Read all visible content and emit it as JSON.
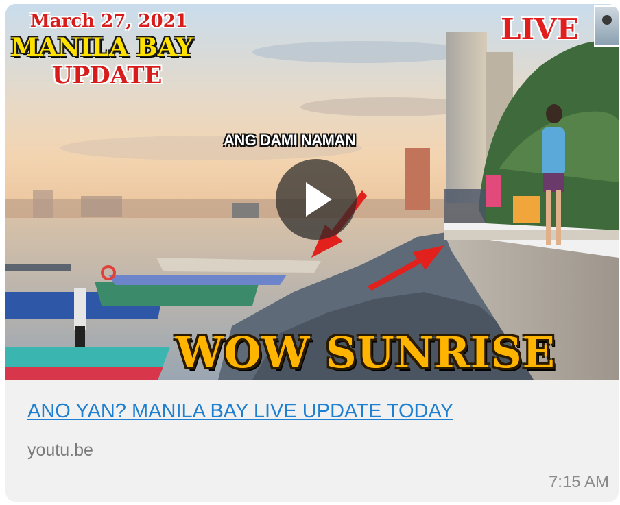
{
  "preview": {
    "overlay": {
      "date": "March 27, 2021",
      "title": "MANILA BAY",
      "subtitle": "UPDATE",
      "live_badge": "LIVE",
      "caption": "ANG DAMI NAMAN",
      "banner": "WOW SUNRISE"
    },
    "play_icon": "play-icon",
    "accent_colors": {
      "title_yellow": "#ffe100",
      "red": "#d81b1b",
      "banner_orange": "#ffb400"
    }
  },
  "link": {
    "title": "ANO YAN? MANILA BAY LIVE UPDATE TODAY",
    "domain": "youtu.be",
    "color": "#1f7fd1"
  },
  "message": {
    "time": "7:15 AM"
  }
}
